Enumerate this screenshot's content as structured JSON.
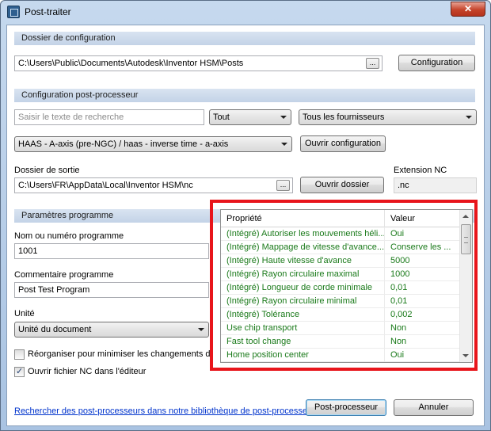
{
  "window": {
    "title": "Post-traiter",
    "close_glyph": "✕"
  },
  "config_section": {
    "header": "Dossier de configuration",
    "path": "C:\\Users\\Public\\Documents\\Autodesk\\Inventor HSM\\Posts",
    "browse_label": "...",
    "button_label": "Configuration"
  },
  "post_section": {
    "header": "Configuration post-processeur",
    "search_placeholder": "Saisir le texte de recherche",
    "filter_value": "Tout",
    "vendor_value": "Tous les fournisseurs",
    "post_value": "HAAS - A-axis (pre-NGC) / haas - inverse time - a-axis",
    "open_config_label": "Ouvrir configuration",
    "output_label": "Dossier de sortie",
    "output_path": "C:\\Users\\FR\\AppData\\Local\\Inventor HSM\\nc",
    "browse_label": "...",
    "open_folder_label": "Ouvrir dossier",
    "extension_label": "Extension NC",
    "extension_value": ".nc"
  },
  "program_section": {
    "header": "Paramètres programme",
    "number_label": "Nom ou numéro programme",
    "number_value": "1001",
    "comment_label": "Commentaire programme",
    "comment_value": "Post Test Program",
    "unit_label": "Unité",
    "unit_value": "Unité du document",
    "reorder_label": "Réorganiser pour minimiser les changements d'ou",
    "reorder_checked": false,
    "open_nc_label": "Ouvrir fichier NC dans l'éditeur",
    "open_nc_checked": true
  },
  "properties": {
    "col_property": "Propriété",
    "col_value": "Valeur",
    "rows": [
      {
        "name": "(Intégré) Autoriser les mouvements héli...",
        "value": "Oui"
      },
      {
        "name": "(Intégré) Mappage de vitesse d'avance...",
        "value": "Conserve les ..."
      },
      {
        "name": "(Intégré) Haute vitesse d'avance",
        "value": "5000"
      },
      {
        "name": "(Intégré) Rayon circulaire maximal",
        "value": "1000"
      },
      {
        "name": "(Intégré) Longueur de corde minimale",
        "value": "0,01"
      },
      {
        "name": "(Intégré) Rayon circulaire minimal",
        "value": "0,01"
      },
      {
        "name": "(Intégré) Tolérance",
        "value": "0,002"
      },
      {
        "name": "Use chip transport",
        "value": "Non"
      },
      {
        "name": "Fast tool change",
        "value": "Non"
      },
      {
        "name": "Home position center",
        "value": "Oui"
      }
    ],
    "text_color": "#1a7a1a",
    "highlight_color": "#e8151b"
  },
  "footer": {
    "library_link": "Rechercher des post-processeurs dans notre bibliothèque de post-processeurs",
    "post_button": "Post-processeur",
    "cancel_button": "Annuler"
  }
}
